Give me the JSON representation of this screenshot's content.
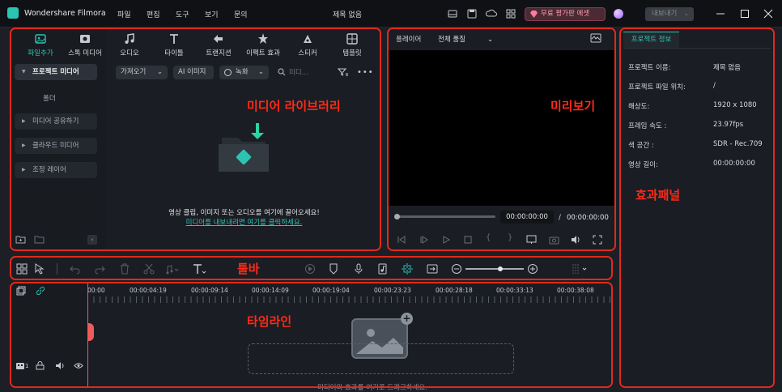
{
  "app": {
    "name": "Wondershare Filmora",
    "document_title": "제목 없음"
  },
  "menu": [
    "파일",
    "편집",
    "도구",
    "보기",
    "문의"
  ],
  "feedback_label": "무료 평가판 에셋",
  "export_label": "내보내기",
  "media_tabs": [
    {
      "label": "파일추가",
      "icon": "media-icon"
    },
    {
      "label": "스톡 미디어",
      "icon": "stock-media-icon"
    },
    {
      "label": "오디오",
      "icon": "music-note-icon"
    },
    {
      "label": "타이틀",
      "icon": "title-t-icon"
    },
    {
      "label": "트랜지션",
      "icon": "transition-icon"
    },
    {
      "label": "이펙트 효과",
      "icon": "effects-icon"
    },
    {
      "label": "스티커",
      "icon": "sticker-icon"
    },
    {
      "label": "템플릿",
      "icon": "template-icon"
    }
  ],
  "library": {
    "project_media": "프로젝트 미디어",
    "folder": "폴더",
    "shared_media": "미디어 공유하기",
    "cloud_media": "클라우드 미디어",
    "adjustment_layer": "조정 레이어",
    "import_label": "가져오기",
    "ai_image_label": "AI 이미지",
    "record_label": "녹화",
    "search_placeholder": "미디...",
    "empty_text": "영상 클립, 이미지 또는 오디오를 여기에 끌어오세요!",
    "import_link": "미디어를 내보내려면 여기를 클릭하세요."
  },
  "player": {
    "tab_label": "플레이어",
    "quality_label": "전체 품질",
    "current_time": "00:00:00:00",
    "separator": "/",
    "total_time": "00:00:00:00"
  },
  "project_info": {
    "tab_label": "프로젝트 정보",
    "rows": [
      {
        "label": "프로젝트 이름:",
        "value": "제목 없음"
      },
      {
        "label": "프로젝트 파일 위치:",
        "value": "/"
      },
      {
        "label": "해상도:",
        "value": "1920 x 1080"
      },
      {
        "label": "프레임 속도 :",
        "value": "23.97fps"
      },
      {
        "label": "색 공간 :",
        "value": "SDR - Rec.709"
      },
      {
        "label": "영상 길이:",
        "value": "00:00:00:00"
      }
    ]
  },
  "timeline": {
    "ticks": [
      "00:00",
      "00:00:04:19",
      "00:00:09:14",
      "00:00:14:09",
      "00:00:19:04",
      "00:00:23:23",
      "00:00:28:18",
      "00:00:33:13",
      "00:00:38:08"
    ],
    "drop_hint": "미디어와 효과를 여기로 드래그하세요.",
    "track_count": "1"
  },
  "annotations": {
    "media_library": "미디어 라이브러리",
    "preview": "미리보기",
    "effects_panel": "효과패널",
    "toolbar": "툴바",
    "timeline": "타임라인"
  },
  "colors": {
    "accent": "#2bc4b3",
    "annotation": "#e02a1c",
    "playhead": "#f05a5a"
  }
}
